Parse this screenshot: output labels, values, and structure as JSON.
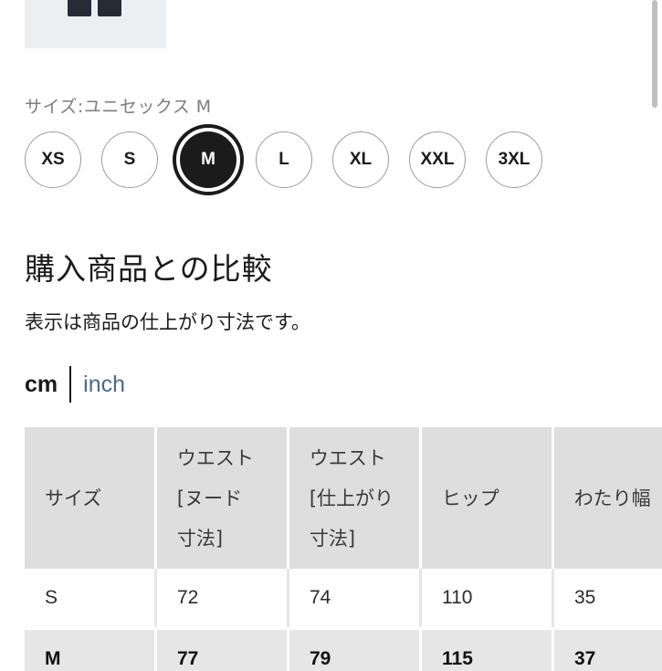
{
  "size_selector": {
    "label": "サイズ:ユニセックス M",
    "options": [
      "XS",
      "S",
      "M",
      "L",
      "XL",
      "XXL",
      "3XL"
    ],
    "selected": "M"
  },
  "comparison": {
    "title": "購入商品との比較",
    "note": "表示は商品の仕上がり寸法です。"
  },
  "units": {
    "cm": "cm",
    "inch": "inch",
    "active": "cm"
  },
  "table": {
    "headers": [
      [
        "サイズ"
      ],
      [
        "ウエスト",
        "[ヌード",
        "寸法]"
      ],
      [
        "ウエスト",
        "[仕上がり",
        "寸法]"
      ],
      [
        "ヒップ"
      ],
      [
        "わたり幅"
      ]
    ],
    "rows": [
      [
        "S",
        "72",
        "74",
        "110",
        "35"
      ],
      [
        "M",
        "77",
        "79",
        "115",
        "37"
      ]
    ],
    "selected_row": 1
  }
}
